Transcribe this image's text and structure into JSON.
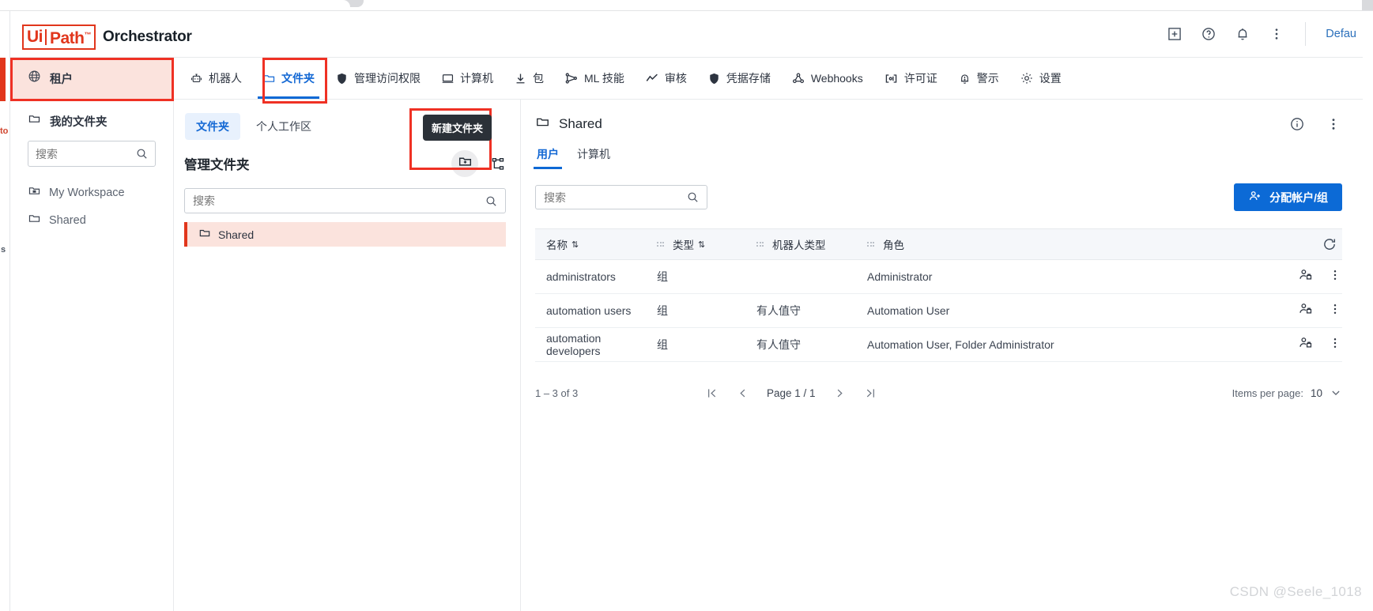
{
  "browser": {
    "tab_placeholder": ""
  },
  "header": {
    "logo_ui": "Ui",
    "logo_path": "Path",
    "logo_tm": "™",
    "product": "Orchestrator",
    "icons": [
      "grid-plus-icon",
      "help-icon",
      "bell-icon",
      "more-vertical-icon"
    ],
    "tenant_label": "Defau"
  },
  "nav": {
    "tenant": {
      "label": "租户",
      "icon": "globe-icon"
    },
    "items": [
      {
        "label": "机器人",
        "icon": "robot-icon",
        "active": false
      },
      {
        "label": "文件夹",
        "icon": "folder-icon",
        "active": true
      },
      {
        "label": "管理访问权限",
        "icon": "shield-icon",
        "active": false
      },
      {
        "label": "计算机",
        "icon": "monitor-icon",
        "active": false
      },
      {
        "label": "包",
        "icon": "download-icon",
        "active": false
      },
      {
        "label": "ML 技能",
        "icon": "ml-skill-icon",
        "active": false
      },
      {
        "label": "审核",
        "icon": "chart-line-icon",
        "active": false
      },
      {
        "label": "凭据存储",
        "icon": "shield-key-icon",
        "active": false
      },
      {
        "label": "Webhooks",
        "icon": "webhook-icon",
        "active": false
      },
      {
        "label": "许可证",
        "icon": "license-icon",
        "active": false
      },
      {
        "label": "警示",
        "icon": "alert-bell-icon",
        "active": false
      },
      {
        "label": "设置",
        "icon": "gear-icon",
        "active": false
      }
    ]
  },
  "sidebar": {
    "title": "租户",
    "title_icon": "globe-icon",
    "section_label": "我的文件夹",
    "section_icon": "folder-icon",
    "search_placeholder": "搜索",
    "search_value": "",
    "items": [
      {
        "label": "My Workspace",
        "icon": "workspace-folder-icon"
      },
      {
        "label": "Shared",
        "icon": "folder-icon"
      }
    ]
  },
  "folders_panel": {
    "tabs": [
      {
        "label": "文件夹",
        "active": true
      },
      {
        "label": "个人工作区",
        "active": false
      }
    ],
    "title": "管理文件夹",
    "new_folder_tooltip": "新建文件夹",
    "new_folder_icon": "folder-plus-icon",
    "org_chart_icon": "hierarchy-icon",
    "search_placeholder": "搜索",
    "search_value": "",
    "tree": [
      {
        "label": "Shared",
        "icon": "folder-icon",
        "selected": true
      }
    ]
  },
  "content": {
    "title": "Shared",
    "title_icon": "folder-icon",
    "header_icons": [
      "info-icon",
      "more-vertical-icon"
    ],
    "tabs": [
      {
        "label": "用户",
        "active": true
      },
      {
        "label": "计算机",
        "active": false
      }
    ],
    "search_placeholder": "搜索",
    "search_value": "",
    "assign_button": {
      "label": "分配帐户/组",
      "icon": "user-add-icon",
      "color": "#0c6ad6"
    },
    "table": {
      "columns": [
        {
          "label": "名称",
          "sortable": true
        },
        {
          "label": "类型",
          "sortable": true
        },
        {
          "label": "机器人类型",
          "sortable": false
        },
        {
          "label": "角色",
          "sortable": false
        }
      ],
      "refresh_icon": "refresh-icon",
      "rows": [
        {
          "name": "administrators",
          "type": "组",
          "robot_type": "",
          "role": "Administrator"
        },
        {
          "name": "automation users",
          "type": "组",
          "robot_type": "有人值守",
          "role": "Automation User"
        },
        {
          "name": "automation developers",
          "type": "组",
          "robot_type": "有人值守",
          "role": "Automation User, Folder Administrator"
        }
      ]
    },
    "pagination": {
      "count": "1 – 3 of 3",
      "page_label": "Page 1 / 1",
      "items_per_page_label": "Items per page:",
      "items_per_page_value": "10",
      "first_icon": "page-first-icon",
      "prev_icon": "chevron-left-icon",
      "next_icon": "chevron-right-icon",
      "last_icon": "page-last-icon",
      "dropdown_icon": "chevron-down-icon"
    }
  },
  "edge_fragments": {
    "left_top": "to",
    "left_mid": "s"
  },
  "watermark": "CSDN @Seele_1018"
}
